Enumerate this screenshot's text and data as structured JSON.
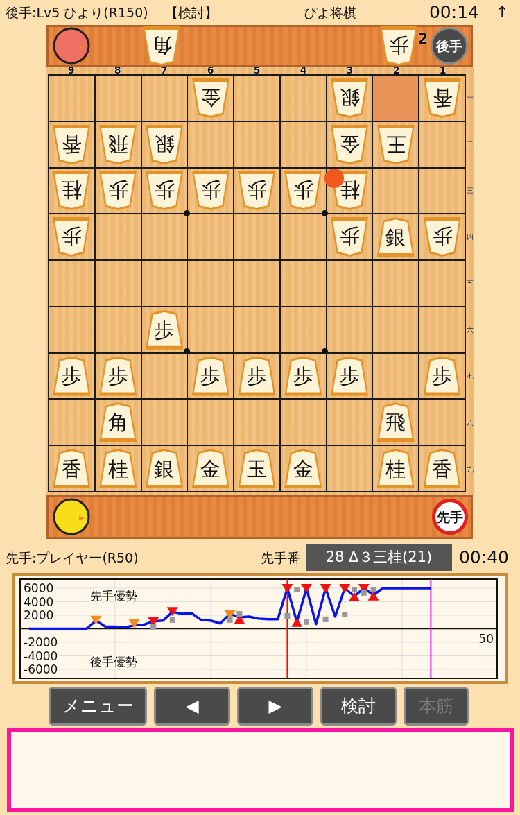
{
  "header": {
    "player": "後手:Lv5 ひより(R150)",
    "mode": "【検討】",
    "title": "ぴよ将棋",
    "clock": "00:14",
    "arrow": "↑"
  },
  "gote_hand": {
    "badge": "後手",
    "pieces": [
      {
        "piece": "角"
      },
      {
        "piece": "歩",
        "count": "2"
      }
    ]
  },
  "board": {
    "files": [
      "9",
      "8",
      "7",
      "6",
      "5",
      "4",
      "3",
      "2",
      "1"
    ],
    "ranks": [
      "一",
      "二",
      "三",
      "四",
      "五",
      "六",
      "七",
      "八",
      "九"
    ],
    "rows": [
      [
        null,
        null,
        null,
        {
          "piece": "金",
          "opponent": true,
          "highlighted": false,
          "dot": false
        },
        null,
        null,
        {
          "piece": "銀",
          "opponent": true,
          "highlighted": false,
          "dot": false
        },
        {
          "highlighted": true,
          "dot": false
        },
        {
          "piece": "香",
          "opponent": true,
          "highlighted": false,
          "dot": false
        }
      ],
      [
        {
          "piece": "香",
          "opponent": true,
          "highlighted": false,
          "dot": false
        },
        {
          "piece": "飛",
          "opponent": true,
          "highlighted": false,
          "dot": false
        },
        {
          "piece": "銀",
          "opponent": true,
          "highlighted": false,
          "dot": false
        },
        null,
        null,
        null,
        {
          "piece": "金",
          "opponent": true,
          "highlighted": false,
          "dot": false
        },
        {
          "piece": "王",
          "opponent": true,
          "highlighted": false,
          "dot": false
        },
        null
      ],
      [
        {
          "piece": "桂",
          "opponent": true,
          "highlighted": false,
          "dot": false
        },
        {
          "piece": "歩",
          "opponent": true,
          "highlighted": false,
          "dot": false
        },
        {
          "piece": "歩",
          "opponent": true,
          "highlighted": false,
          "dot": false
        },
        {
          "piece": "歩",
          "opponent": true,
          "highlighted": false,
          "dot": false
        },
        {
          "piece": "歩",
          "opponent": true,
          "highlighted": false,
          "dot": false
        },
        {
          "piece": "歩",
          "opponent": true,
          "highlighted": false,
          "dot": false
        },
        {
          "piece": "桂",
          "opponent": true,
          "highlighted": false,
          "dot": true
        },
        null,
        null
      ],
      [
        {
          "piece": "歩",
          "opponent": true,
          "highlighted": false,
          "dot": false
        },
        null,
        null,
        null,
        null,
        null,
        {
          "piece": "歩",
          "opponent": true,
          "highlighted": false,
          "dot": false
        },
        {
          "piece": "銀",
          "opponent": false,
          "highlighted": false,
          "dot": false
        },
        {
          "piece": "歩",
          "opponent": true,
          "highlighted": false,
          "dot": false
        }
      ],
      [
        null,
        null,
        null,
        null,
        null,
        null,
        null,
        null,
        null
      ],
      [
        null,
        null,
        {
          "piece": "歩",
          "opponent": false,
          "highlighted": false,
          "dot": false
        },
        null,
        null,
        null,
        null,
        null,
        null
      ],
      [
        {
          "piece": "歩",
          "opponent": false,
          "highlighted": false,
          "dot": false
        },
        {
          "piece": "歩",
          "opponent": false,
          "highlighted": false,
          "dot": false
        },
        null,
        {
          "piece": "歩",
          "opponent": false,
          "highlighted": false,
          "dot": false
        },
        {
          "piece": "歩",
          "opponent": false,
          "highlighted": false,
          "dot": false
        },
        {
          "piece": "歩",
          "opponent": false,
          "highlighted": false,
          "dot": false
        },
        {
          "piece": "歩",
          "opponent": false,
          "highlighted": false,
          "dot": false
        },
        null,
        {
          "piece": "歩",
          "opponent": false,
          "highlighted": false,
          "dot": false
        }
      ],
      [
        null,
        {
          "piece": "角",
          "opponent": false,
          "highlighted": false,
          "dot": false
        },
        null,
        null,
        null,
        null,
        null,
        {
          "piece": "飛",
          "opponent": false,
          "highlighted": false,
          "dot": false
        },
        null
      ],
      [
        {
          "piece": "香",
          "opponent": false,
          "highlighted": false,
          "dot": false
        },
        {
          "piece": "桂",
          "opponent": false,
          "highlighted": false,
          "dot": false
        },
        {
          "piece": "銀",
          "opponent": false,
          "highlighted": false,
          "dot": false
        },
        {
          "piece": "金",
          "opponent": false,
          "highlighted": false,
          "dot": false
        },
        {
          "piece": "玉",
          "opponent": false,
          "highlighted": false,
          "dot": false
        },
        {
          "piece": "金",
          "opponent": false,
          "highlighted": false,
          "dot": false
        },
        null,
        {
          "piece": "桂",
          "opponent": false,
          "highlighted": false,
          "dot": false
        },
        {
          "piece": "香",
          "opponent": false,
          "highlighted": false,
          "dot": false
        }
      ]
    ]
  },
  "sente_hand": {
    "badge": "先手"
  },
  "info": {
    "player": "先手:プレイヤー(R50)",
    "turn": "先手番",
    "move": "28 ∆３三桂(21)",
    "clock": "00:40"
  },
  "chart": {
    "chart_data": {
      "type": "line",
      "grid": true,
      "ylim": [
        -6000,
        6000
      ],
      "yticks": [
        {
          "value": 6000,
          "label": "6000"
        },
        {
          "value": 4000,
          "label": "4000"
        },
        {
          "value": 2000,
          "label": "2000"
        },
        {
          "value": -2000,
          "label": "-2000"
        },
        {
          "value": -4000,
          "label": "-4000"
        },
        {
          "value": -6000,
          "label": "-6000"
        }
      ],
      "categories": [
        null,
        null,
        null,
        null,
        null,
        null,
        null,
        null,
        null,
        null,
        null,
        null,
        null,
        null,
        null,
        null,
        null,
        null,
        null,
        null,
        null,
        null,
        null,
        null,
        null,
        null,
        null,
        null,
        null,
        null,
        null,
        null,
        null,
        null,
        null,
        null,
        null,
        null,
        null,
        null,
        null,
        null,
        null,
        null,
        null,
        null,
        null,
        null,
        null,
        null
      ],
      "series": [
        {
          "color": "#0a14e6",
          "values": [
            0,
            0,
            0,
            0,
            0,
            0,
            0,
            1200,
            300,
            300,
            200,
            500,
            600,
            1100,
            1200,
            2500,
            2200,
            2300,
            1300,
            1200,
            800,
            2200,
            1700,
            1800,
            1500,
            1400,
            1400,
            6000,
            1000,
            6000,
            700,
            6000,
            1800,
            6000,
            4800,
            6000,
            5000,
            6000,
            6000,
            6000,
            6000,
            6000,
            6000,
            null,
            null,
            null,
            null,
            null,
            null,
            null
          ]
        },
        {
          "type": "scatter",
          "color": "#f28c1c",
          "marker": "triangle-down",
          "values": [
            null,
            null,
            null,
            null,
            null,
            null,
            null,
            1300,
            null,
            null,
            null,
            800,
            null,
            null,
            null,
            null,
            null,
            null,
            null,
            null,
            null,
            2100,
            null,
            null,
            null,
            null,
            null,
            null,
            null,
            null,
            null,
            null,
            null,
            null,
            null,
            null,
            null,
            null,
            null,
            null,
            null,
            null,
            null,
            null,
            null,
            null,
            null,
            null,
            null,
            null
          ]
        },
        {
          "type": "scatter",
          "color": "#ee1111",
          "marker": "triangle-down",
          "values": [
            null,
            null,
            null,
            null,
            null,
            null,
            null,
            null,
            null,
            null,
            null,
            null,
            null,
            1100,
            null,
            2600,
            null,
            null,
            null,
            null,
            null,
            null,
            null,
            null,
            null,
            null,
            null,
            6000,
            null,
            6000,
            null,
            6000,
            null,
            6000,
            null,
            6000,
            null,
            null,
            null,
            null,
            null,
            null,
            null,
            null,
            null,
            null,
            null,
            null,
            null,
            null
          ]
        },
        {
          "type": "scatter",
          "color": "#ee1111",
          "marker": "triangle-up",
          "values": [
            null,
            null,
            null,
            null,
            null,
            null,
            null,
            null,
            null,
            null,
            null,
            null,
            null,
            null,
            null,
            null,
            null,
            null,
            null,
            null,
            null,
            null,
            1300,
            null,
            null,
            null,
            null,
            null,
            900,
            null,
            null,
            null,
            null,
            null,
            4700,
            null,
            4800,
            null,
            null,
            null,
            null,
            null,
            null,
            null,
            null,
            null,
            null,
            null,
            null,
            null
          ]
        },
        {
          "type": "scatter",
          "color": "#999999",
          "marker": "square",
          "values": [
            null,
            null,
            null,
            null,
            null,
            null,
            null,
            null,
            null,
            null,
            null,
            null,
            null,
            300,
            null,
            1300,
            null,
            null,
            null,
            null,
            null,
            1300,
            2200,
            null,
            null,
            null,
            null,
            1900,
            5800,
            1000,
            null,
            1400,
            null,
            2100,
            5800,
            5300,
            5800,
            null,
            null,
            null,
            null,
            null,
            null,
            null,
            null,
            null,
            null,
            null,
            null,
            null
          ]
        }
      ],
      "annotations": [
        {
          "text": "先手優勢"
        },
        {
          "text": "後手優勢"
        },
        {
          "text": "50"
        }
      ]
    }
  },
  "buttons": [
    {
      "label": "メニュー",
      "disabled": false
    },
    {
      "label": "◀",
      "disabled": false
    },
    {
      "label": "▶",
      "disabled": false
    },
    {
      "label": "検討",
      "disabled": false
    },
    {
      "label": "本筋",
      "disabled": true
    }
  ],
  "comment_box": {
    "kind": "empty"
  }
}
